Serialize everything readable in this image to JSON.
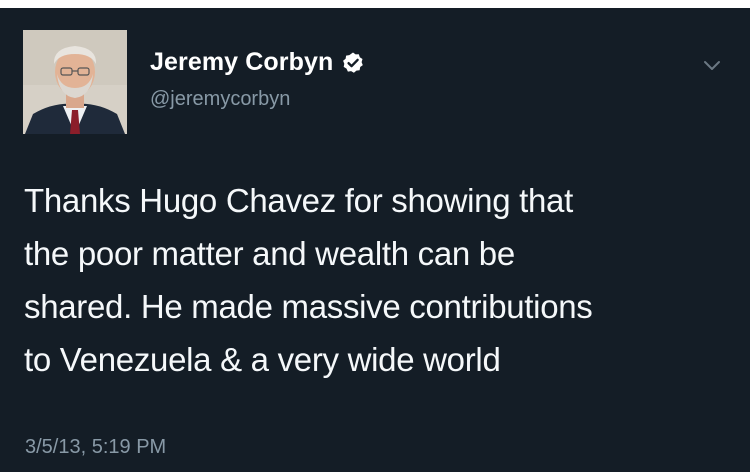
{
  "tweet": {
    "author_name": "Jeremy Corbyn",
    "author_handle": "@jeremycorbyn",
    "text": "Thanks Hugo Chavez for showing that\nthe poor matter and wealth can be\nshared. He made massive contributions\nto Venezuela & a very wide world",
    "timestamp": "3/5/13, 5:19 PM",
    "verified": true
  },
  "icons": {
    "verified": "verified-badge-icon",
    "more": "chevron-down-icon"
  },
  "colors": {
    "background": "#141d26",
    "text": "#f5f8fa",
    "secondary_text": "#8899a6",
    "top_border": "#ffffff"
  }
}
